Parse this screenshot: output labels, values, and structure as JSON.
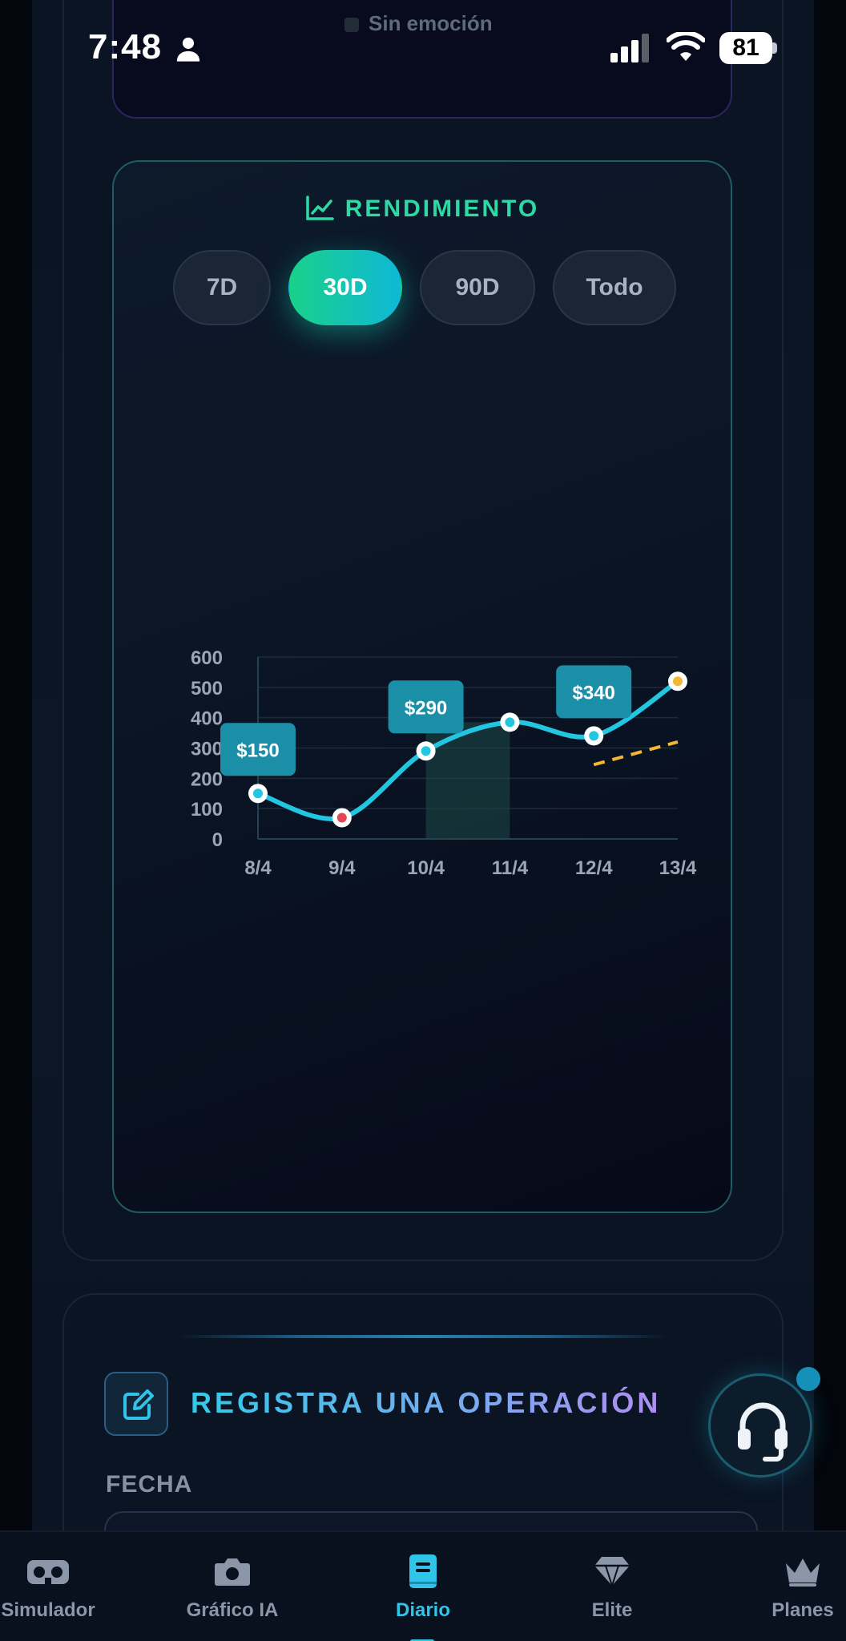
{
  "status_bar": {
    "time": "7:48",
    "battery": "81",
    "person_icon": "person-icon",
    "signal_icon": "cellular-signal-icon",
    "wifi_icon": "wifi-icon"
  },
  "previous_card": {
    "emotion_label": "Sin emoción"
  },
  "performance": {
    "title": "RENDIMIENTO",
    "title_icon": "line-chart-icon",
    "accent_color": "#2fd9a4",
    "ranges": [
      {
        "label": "7D",
        "active": false
      },
      {
        "label": "30D",
        "active": true
      },
      {
        "label": "90D",
        "active": false
      },
      {
        "label": "Todo",
        "active": false
      }
    ]
  },
  "chart_data": {
    "type": "line",
    "x": [
      "8/4",
      "9/4",
      "10/4",
      "11/4",
      "12/4",
      "13/4"
    ],
    "series": [
      {
        "values": [
          150,
          70,
          290,
          385,
          340,
          520
        ],
        "color": "#22c6e0"
      }
    ],
    "point_colors": [
      "#22c6e0",
      "#e64553",
      "#22c6e0",
      "#22c6e0",
      "#22c6e0",
      "#f5b731"
    ],
    "data_labels": [
      {
        "x": "8/4",
        "text": "$150"
      },
      {
        "x": "10/4",
        "text": "$290"
      },
      {
        "x": "12/4",
        "text": "$340"
      }
    ],
    "highlight_range": [
      "10/4",
      "11/4"
    ],
    "trend_line": {
      "from": [
        "12/4",
        245
      ],
      "to": [
        "13/4",
        320
      ],
      "color": "#f5b731",
      "style": "dashed"
    },
    "yticks": [
      "600",
      "500",
      "400",
      "300",
      "200",
      "100",
      "0"
    ],
    "ylim": [
      0,
      600
    ],
    "grid": true,
    "title": "",
    "xlabel": "",
    "ylabel": ""
  },
  "register": {
    "title": "REGISTRA UNA OPERACIÓN",
    "icon": "edit-icon",
    "date_label": "FECHA"
  },
  "support": {
    "icon": "headset-icon"
  },
  "bottom_nav": [
    {
      "label": "Simulador",
      "icon": "vr-headset-icon",
      "active": false
    },
    {
      "label": "Gráfico IA",
      "icon": "camera-icon",
      "active": false
    },
    {
      "label": "Diario",
      "icon": "book-icon",
      "active": true
    },
    {
      "label": "Elite",
      "icon": "diamond-icon",
      "active": false
    },
    {
      "label": "Planes",
      "icon": "crown-icon",
      "active": false
    }
  ]
}
